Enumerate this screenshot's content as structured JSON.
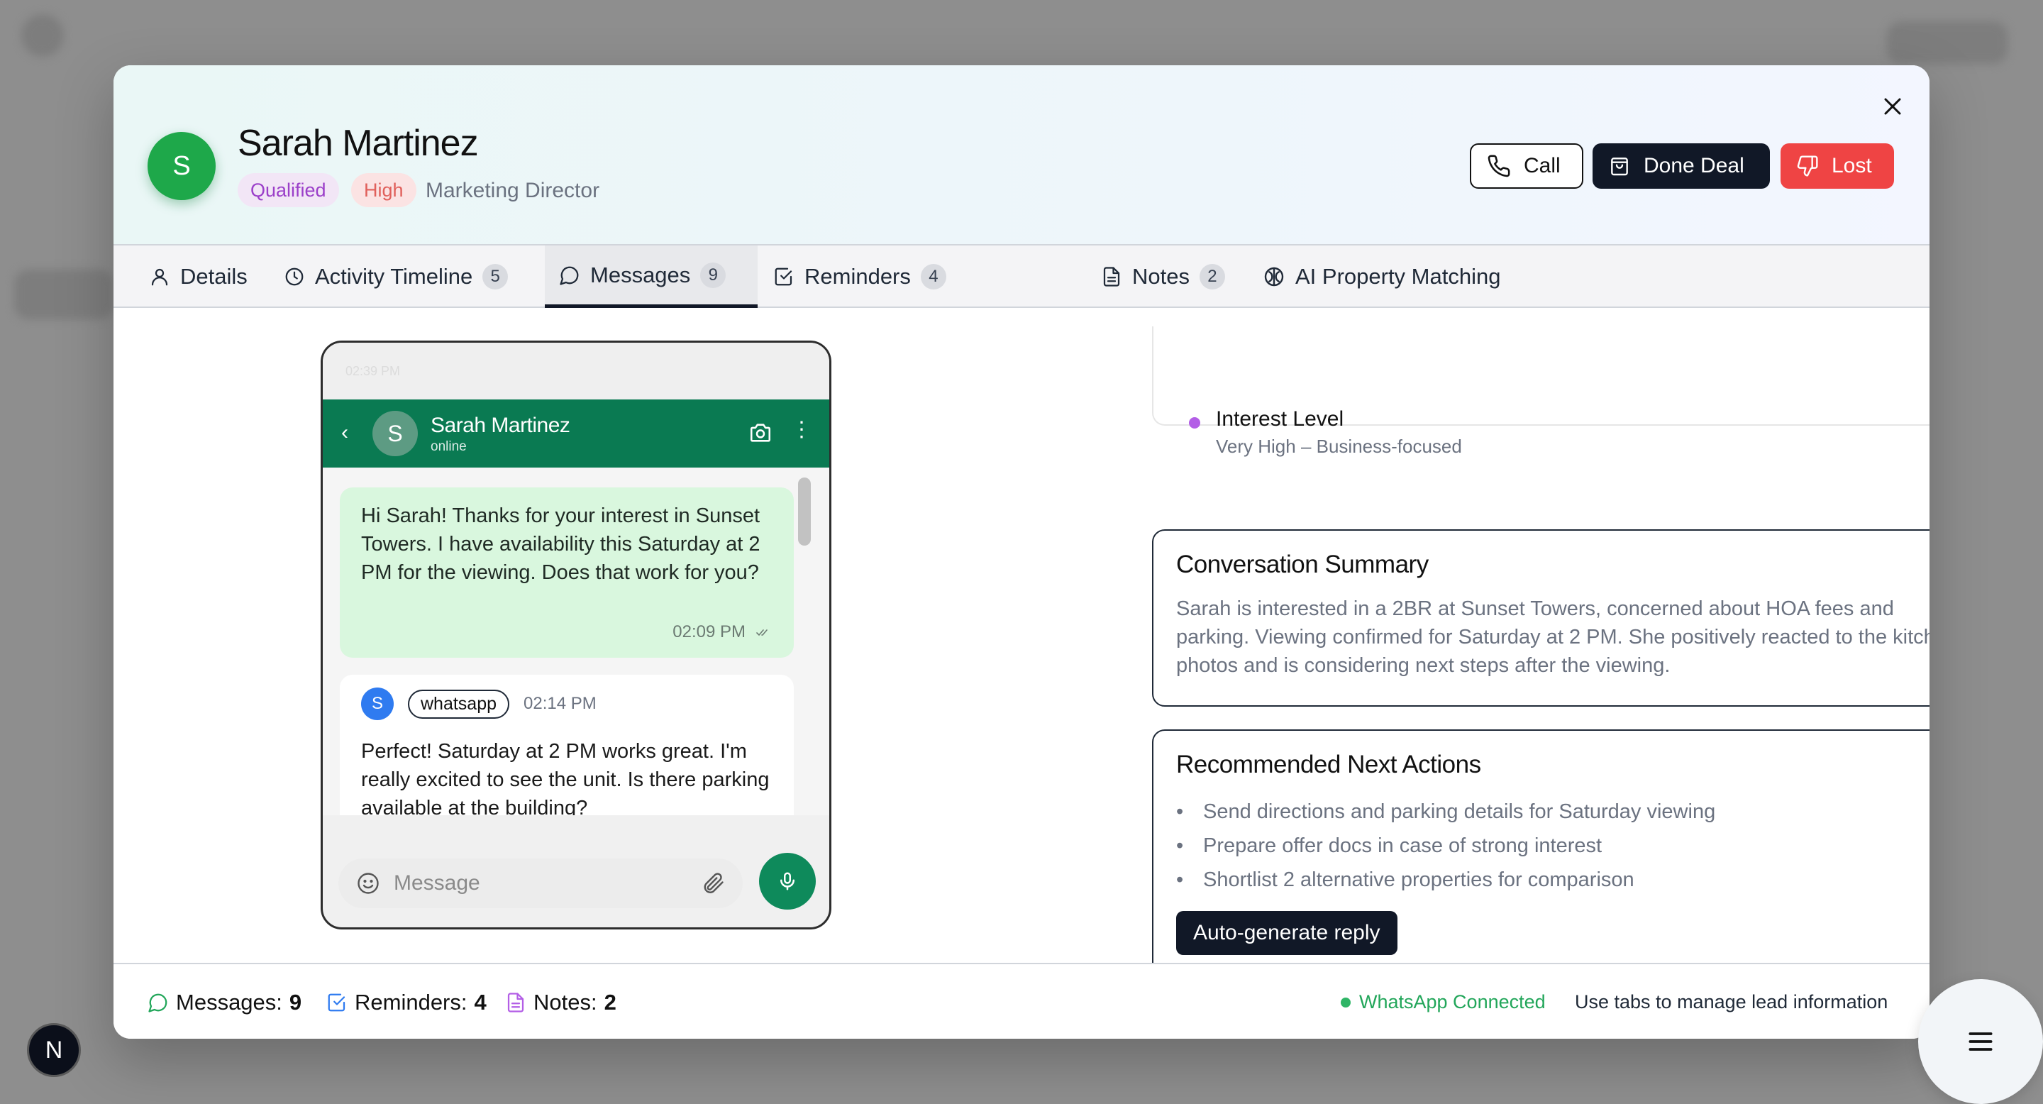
{
  "lead": {
    "initial": "S",
    "name": "Sarah Martinez",
    "status_badge": "Qualified",
    "priority_badge": "High",
    "role": "Marketing Director"
  },
  "header_actions": {
    "call_label": "Call",
    "done_deal_label": "Done Deal",
    "lost_label": "Lost"
  },
  "tabs": [
    {
      "label": "Details",
      "icon": "user-icon"
    },
    {
      "label": "Activity Timeline",
      "count": "5",
      "icon": "clock-icon"
    },
    {
      "label": "Messages",
      "count": "9",
      "icon": "chat-bubble-icon",
      "active": true
    },
    {
      "label": "Reminders",
      "count": "4",
      "icon": "checkbox-icon"
    },
    {
      "label": "Notes",
      "count": "2",
      "icon": "document-icon"
    },
    {
      "label": "AI Property Matching",
      "icon": "brain-icon"
    }
  ],
  "phone": {
    "status_time": "02:39 PM",
    "contact_initial": "S",
    "contact_name": "Sarah Martinez",
    "contact_status": "online",
    "messages": [
      {
        "direction": "outgoing",
        "text": "Hi Sarah! Thanks for your interest in Sunset Towers. I have availability this Saturday at 2 PM for the viewing. Does that work for you?",
        "time": "02:09 PM"
      },
      {
        "direction": "incoming",
        "avatar": "S",
        "channel": "whatsapp",
        "time": "02:14 PM",
        "text": "Perfect! Saturday at 2 PM works great. I'm really excited to see the unit. Is there parking available at the building?"
      }
    ],
    "compose_placeholder": "Message"
  },
  "insights": {
    "interest_label": "Interest Level",
    "interest_value": "Very High – Business-focused",
    "summary_title": "Conversation Summary",
    "summary_text": "Sarah is interested in a 2BR at Sunset Towers, concerned about HOA fees and parking. Viewing confirmed for Saturday at 2 PM. She positively reacted to the kitchen photos and is considering next steps after the viewing.",
    "next_actions_title": "Recommended Next Actions",
    "next_actions": [
      "Send directions and parking details for Saturday viewing",
      "Prepare offer docs in case of strong interest",
      "Shortlist 2 alternative properties for comparison"
    ],
    "auto_reply_label": "Auto-generate reply"
  },
  "footer": {
    "messages_label": "Messages:",
    "messages_count": "9",
    "reminders_label": "Reminders:",
    "reminders_count": "4",
    "notes_label": "Notes:",
    "notes_count": "2",
    "whatsapp_status": "WhatsApp Connected",
    "hint": "Use tabs to manage lead information"
  },
  "dev_badge": "N",
  "colors": {
    "brand_green": "#1ea84a",
    "whatsapp_green": "#0a7a52",
    "lost_red": "#ef4444",
    "dark": "#111827",
    "qualified_purple": "#9b3fc9"
  }
}
